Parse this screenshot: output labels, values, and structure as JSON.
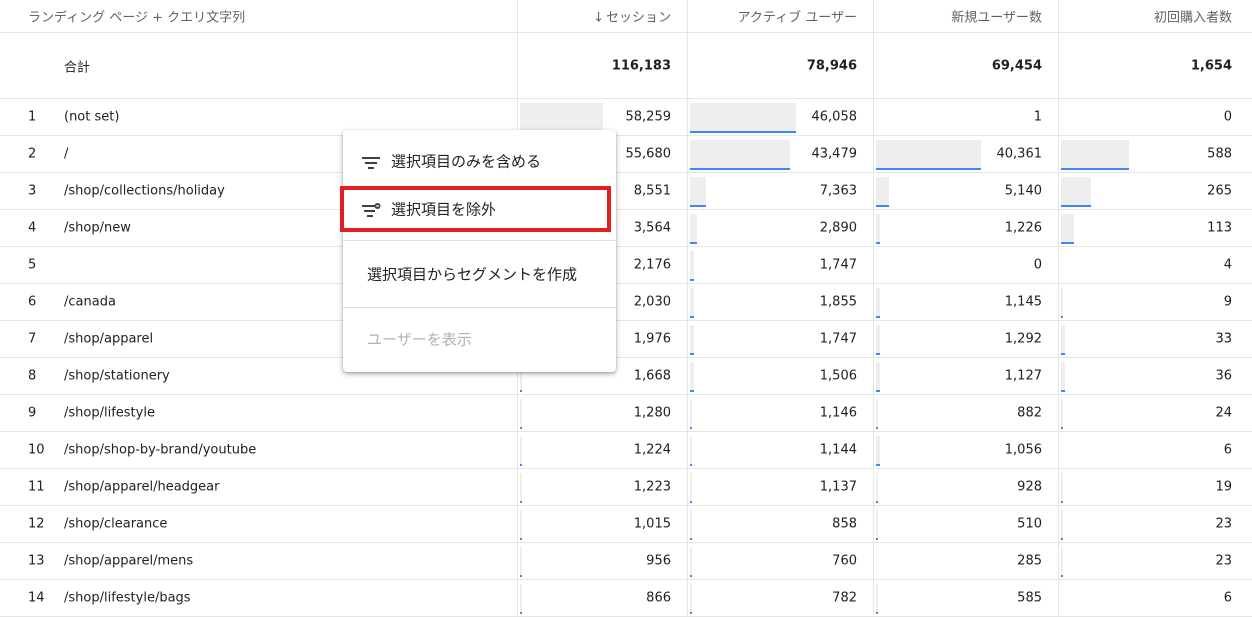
{
  "header": {
    "dimension": "ランディング ページ + クエリ文字列",
    "sort_arrow": "↓",
    "metrics": [
      "セッション",
      "アクティブ ユーザー",
      "新規ユーザー数",
      "初回購入者数"
    ]
  },
  "totals": {
    "label": "合計",
    "values": [
      "116,183",
      "78,946",
      "69,454",
      "1,654"
    ]
  },
  "rows": [
    {
      "index": "1",
      "dimension": "(not set)",
      "values": [
        "58,259",
        "46,058",
        "1",
        "0"
      ],
      "shares": [
        0.5,
        0.58,
        0.0,
        0.0
      ]
    },
    {
      "index": "2",
      "dimension": "/",
      "values": [
        "55,680",
        "43,479",
        "40,361",
        "588"
      ],
      "shares": [
        0.48,
        0.55,
        0.58,
        0.36
      ]
    },
    {
      "index": "3",
      "dimension": "/shop/collections/holiday",
      "values": [
        "8,551",
        "7,363",
        "5,140",
        "265"
      ],
      "shares": [
        0.07,
        0.09,
        0.07,
        0.16
      ]
    },
    {
      "index": "4",
      "dimension": "/shop/new",
      "values": [
        "3,564",
        "2,890",
        "1,226",
        "113"
      ],
      "shares": [
        0.03,
        0.04,
        0.02,
        0.07
      ]
    },
    {
      "index": "5",
      "dimension": "",
      "values": [
        "2,176",
        "1,747",
        "0",
        "4"
      ],
      "shares": [
        0.02,
        0.02,
        0.0,
        0.0
      ]
    },
    {
      "index": "6",
      "dimension": "/canada",
      "values": [
        "2,030",
        "1,855",
        "1,145",
        "9"
      ],
      "shares": [
        0.02,
        0.02,
        0.02,
        0.01
      ]
    },
    {
      "index": "7",
      "dimension": "/shop/apparel",
      "values": [
        "1,976",
        "1,747",
        "1,292",
        "33"
      ],
      "shares": [
        0.02,
        0.02,
        0.02,
        0.02
      ]
    },
    {
      "index": "8",
      "dimension": "/shop/stationery",
      "values": [
        "1,668",
        "1,506",
        "1,127",
        "36"
      ],
      "shares": [
        0.01,
        0.02,
        0.02,
        0.02
      ]
    },
    {
      "index": "9",
      "dimension": "/shop/lifestyle",
      "values": [
        "1,280",
        "1,146",
        "882",
        "24"
      ],
      "shares": [
        0.01,
        0.01,
        0.01,
        0.01
      ]
    },
    {
      "index": "10",
      "dimension": "/shop/shop-by-brand/youtube",
      "values": [
        "1,224",
        "1,144",
        "1,056",
        "6"
      ],
      "shares": [
        0.01,
        0.01,
        0.02,
        0.0
      ]
    },
    {
      "index": "11",
      "dimension": "/shop/apparel/headgear",
      "values": [
        "1,223",
        "1,137",
        "928",
        "19"
      ],
      "shares": [
        0.01,
        0.01,
        0.01,
        0.01
      ]
    },
    {
      "index": "12",
      "dimension": "/shop/clearance",
      "values": [
        "1,015",
        "858",
        "510",
        "23"
      ],
      "shares": [
        0.01,
        0.01,
        0.01,
        0.01
      ]
    },
    {
      "index": "13",
      "dimension": "/shop/apparel/mens",
      "values": [
        "956",
        "760",
        "285",
        "23"
      ],
      "shares": [
        0.01,
        0.01,
        0.0,
        0.01
      ]
    },
    {
      "index": "14",
      "dimension": "/shop/lifestyle/bags",
      "values": [
        "866",
        "782",
        "585",
        "6"
      ],
      "shares": [
        0.01,
        0.01,
        0.01,
        0.0
      ]
    }
  ],
  "context_menu": {
    "include_label": "選択項目のみを含める",
    "exclude_label": "選択項目を除外",
    "segment_label": "選択項目からセグメントを作成",
    "view_users_label": "ユーザーを表示",
    "include_icon": "filter-icon",
    "exclude_icon": "filter-remove-icon"
  },
  "colors": {
    "bar_fill": "#eeeeee",
    "bar_accent": "#4285f4",
    "highlight": "#e02020"
  }
}
